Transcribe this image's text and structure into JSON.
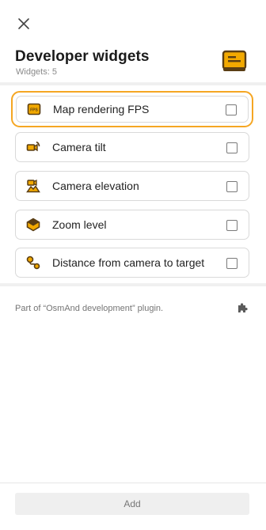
{
  "header": {
    "close_icon": "close-icon",
    "title": "Developer widgets",
    "subtitle": "Widgets: 5",
    "group_icon": "developer-widgets-icon"
  },
  "widgets": [
    {
      "label": "Map rendering FPS",
      "icon": "fps-icon",
      "checked": false,
      "highlighted": true
    },
    {
      "label": "Camera tilt",
      "icon": "camera-tilt-icon",
      "checked": false,
      "highlighted": false
    },
    {
      "label": "Camera elevation",
      "icon": "camera-elevation-icon",
      "checked": false,
      "highlighted": false
    },
    {
      "label": "Zoom level",
      "icon": "zoom-level-icon",
      "checked": false,
      "highlighted": false
    },
    {
      "label": "Distance from camera to target",
      "icon": "distance-camera-target-icon",
      "checked": false,
      "highlighted": false
    }
  ],
  "footer": {
    "plugin_text": "Part of “OsmAnd development” plugin.",
    "plugin_icon": "puzzle-piece-icon"
  },
  "actions": {
    "add_label": "Add"
  },
  "colors": {
    "accent": "#f5a623",
    "icon_fill": "#f2a900",
    "icon_outline": "#5a3e14"
  }
}
